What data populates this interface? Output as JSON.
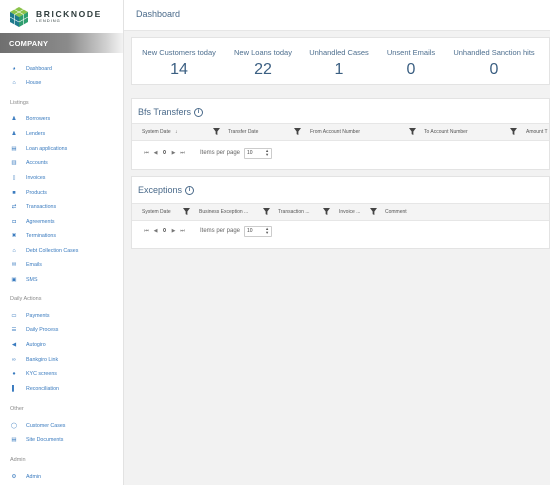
{
  "brand": {
    "name": "BRICKNODE",
    "sub": "LENDING"
  },
  "sidebar": {
    "company": "COMPANY",
    "top_items": [
      {
        "label": "Dashboard",
        "icon": "dashboard-icon"
      },
      {
        "label": "House",
        "icon": "home-icon"
      }
    ],
    "sections": [
      {
        "title": "Listings",
        "items": [
          {
            "label": "Borrowers",
            "icon": "users-icon"
          },
          {
            "label": "Lenders",
            "icon": "users-icon"
          },
          {
            "label": "Loan applications",
            "icon": "document-icon"
          },
          {
            "label": "Accounts",
            "icon": "bank-icon"
          },
          {
            "label": "Invoices",
            "icon": "file-icon"
          },
          {
            "label": "Products",
            "icon": "box-icon"
          },
          {
            "label": "Transactions",
            "icon": "exchange-icon"
          },
          {
            "label": "Agreements",
            "icon": "handshake-icon"
          },
          {
            "label": "Terminations",
            "icon": "close-icon"
          },
          {
            "label": "Debt Collection Cases",
            "icon": "bank-icon"
          },
          {
            "label": "Emails",
            "icon": "envelope-icon"
          },
          {
            "label": "SMS",
            "icon": "message-icon"
          }
        ]
      },
      {
        "title": "Daily Actions",
        "items": [
          {
            "label": "Payments",
            "icon": "card-icon"
          },
          {
            "label": "Daily Process",
            "icon": "list-icon"
          },
          {
            "label": "Autogiro",
            "icon": "megaphone-icon"
          },
          {
            "label": "Bankgiro Link",
            "icon": "link-icon"
          },
          {
            "label": "KYC screens",
            "icon": "user-icon"
          },
          {
            "label": "Reconciliation",
            "icon": "book-icon"
          }
        ]
      },
      {
        "title": "Other",
        "items": [
          {
            "label": "Customer Cases",
            "icon": "circle-icon"
          },
          {
            "label": "Site Documents",
            "icon": "document-icon"
          }
        ]
      },
      {
        "title": "Admin",
        "items": [
          {
            "label": "Admin",
            "icon": "gear-icon"
          }
        ]
      }
    ]
  },
  "header": {
    "title": "Dashboard"
  },
  "stats": [
    {
      "label": "New Customers today",
      "value": "14"
    },
    {
      "label": "New Loans today",
      "value": "22"
    },
    {
      "label": "Unhandled Cases",
      "value": "1"
    },
    {
      "label": "Unsent Emails",
      "value": "0"
    },
    {
      "label": "Unhandled Sanction hits",
      "value": "0"
    }
  ],
  "transfers": {
    "title": "Bfs Transfers",
    "columns": [
      "System Date",
      "Transfer Date",
      "From Account Number",
      "To Account Number",
      "Amount T"
    ],
    "sort_arrow": "↓",
    "pager": {
      "page": "0",
      "items_per_page_label": "Items per page",
      "page_size": "10"
    }
  },
  "exceptions": {
    "title": "Exceptions",
    "columns": [
      "System Date",
      "Business Exception ...",
      "Transaction ...",
      "Invoice ...",
      "Comment"
    ],
    "pager": {
      "page": "0",
      "items_per_page_label": "Items per page",
      "page_size": "10"
    }
  },
  "colors": {
    "accent": "#3a7bbf",
    "heading": "#4a6a8a",
    "logo_green": "#4caf50",
    "logo_teal": "#1e7a8c"
  }
}
